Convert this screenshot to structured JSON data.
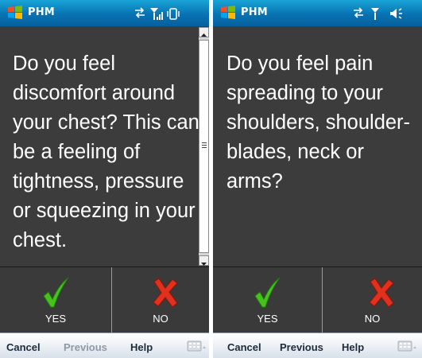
{
  "screens": [
    {
      "title": "PHM",
      "question": "Do you feel discomfort around your chest? This can be a feeling of tightness, pressure or squeezing in your chest.",
      "answers": {
        "yes": "YES",
        "no": "NO"
      },
      "softkeys": {
        "cancel": "Cancel",
        "previous": "Previous",
        "help": "Help",
        "previous_enabled": false
      },
      "status_icons": [
        "connectivity-icon",
        "signal-icon",
        "vibrate-icon"
      ],
      "scrollbar": true
    },
    {
      "title": "PHM",
      "question": "Do you feel pain spreading to your shoulders, shoulder-blades, neck or arms?",
      "answers": {
        "yes": "YES",
        "no": "NO"
      },
      "softkeys": {
        "cancel": "Cancel",
        "previous": "Previous",
        "help": "Help",
        "previous_enabled": true
      },
      "status_icons": [
        "connectivity-icon",
        "signal-icon",
        "speaker-icon"
      ],
      "scrollbar": false
    }
  ],
  "colors": {
    "titlebar": "#0a7fc0",
    "background": "#3c3c3c",
    "yes_check": "#46c21c",
    "no_cross": "#e0301e"
  }
}
